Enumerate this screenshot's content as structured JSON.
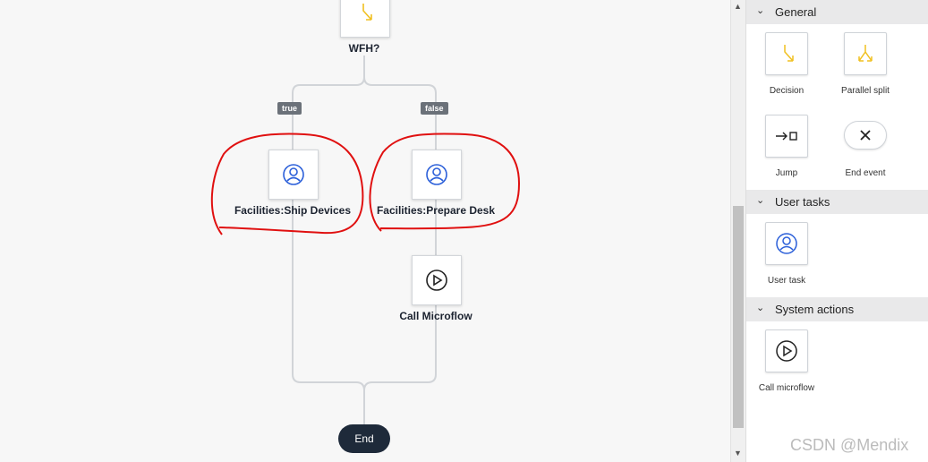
{
  "workflow": {
    "decision_label": "WFH?",
    "branch_true": "true",
    "branch_false": "false",
    "task_ship": "Facilities:Ship Devices",
    "task_prepare": "Facilities:Prepare Desk",
    "call_microflow": "Call Microflow",
    "end": "End"
  },
  "toolbox": {
    "sections": [
      {
        "title": "General",
        "items": [
          {
            "label": "Decision",
            "icon": "decision-icon"
          },
          {
            "label": "Parallel split",
            "icon": "parallel-split-icon"
          },
          {
            "label": "Jump",
            "icon": "jump-icon"
          },
          {
            "label": "End event",
            "icon": "end-event-icon"
          }
        ]
      },
      {
        "title": "User tasks",
        "items": [
          {
            "label": "User task",
            "icon": "user-task-icon"
          }
        ]
      },
      {
        "title": "System actions",
        "items": [
          {
            "label": "Call microflow",
            "icon": "call-microflow-icon"
          }
        ]
      }
    ]
  },
  "colors": {
    "accent_user": "#2b5fd9",
    "decision_yellow": "#f0c020",
    "annotation_red": "#e01010",
    "end_dark": "#1e2a3a"
  },
  "watermark": "CSDN @Mendix"
}
